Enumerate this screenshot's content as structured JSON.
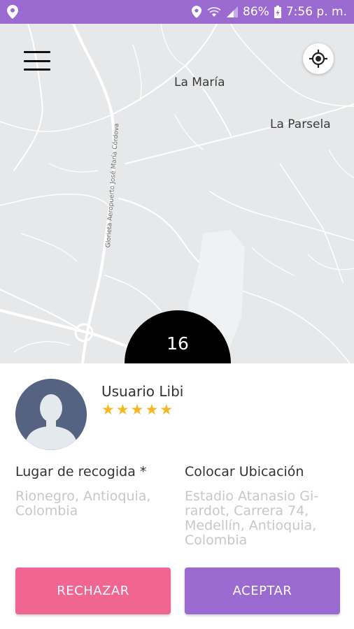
{
  "status_bar": {
    "battery": "86%",
    "time": "7:56 p. m.",
    "icons": [
      "location-pin-icon",
      "wifi-icon",
      "signal-icon",
      "battery-charging-icon"
    ],
    "color": "#9a6ad0"
  },
  "map": {
    "places": [
      "La María",
      "La Parsela"
    ],
    "road_label": "Glorieta Aeropuerto José María Córdova",
    "menu_icon": "hamburger-menu-icon",
    "locate_icon": "my-location-icon"
  },
  "counter": "16",
  "user": {
    "name": "Usuario Libi",
    "rating": 5,
    "avatar_icon": "user-avatar-icon"
  },
  "pickup": {
    "title": "Lugar de recogida *",
    "lines": [
      "Rionegro, Antioquia,",
      "Colombia"
    ]
  },
  "destination": {
    "title": "Colocar Ubicación",
    "lines": [
      "Estadio Atanasio Gi-",
      "rardot, Carrera 74,",
      "Medellín, Antioquia,",
      "Colombia"
    ]
  },
  "buttons": {
    "reject": "RECHAZAR",
    "accept": "ACEPTAR",
    "reject_color": "#f06592",
    "accept_color": "#9a6ad0"
  }
}
